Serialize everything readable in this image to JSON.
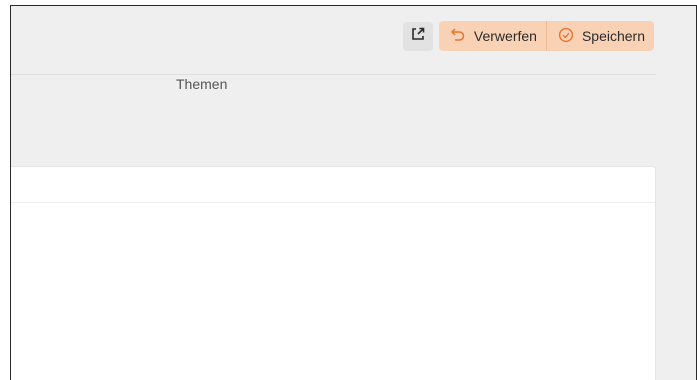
{
  "toolbar": {
    "open_external_icon": "external-link-icon",
    "discard": {
      "label": "Verwerfen",
      "icon": "undo-icon"
    },
    "save": {
      "label": "Speichern",
      "icon": "check-circle-icon"
    }
  },
  "tab": {
    "label": "Themen"
  },
  "colors": {
    "accent_button_bg": "#f9d1b5",
    "accent_icon": "#e8752e",
    "page_bg": "#efefef",
    "card_bg": "#ffffff"
  }
}
